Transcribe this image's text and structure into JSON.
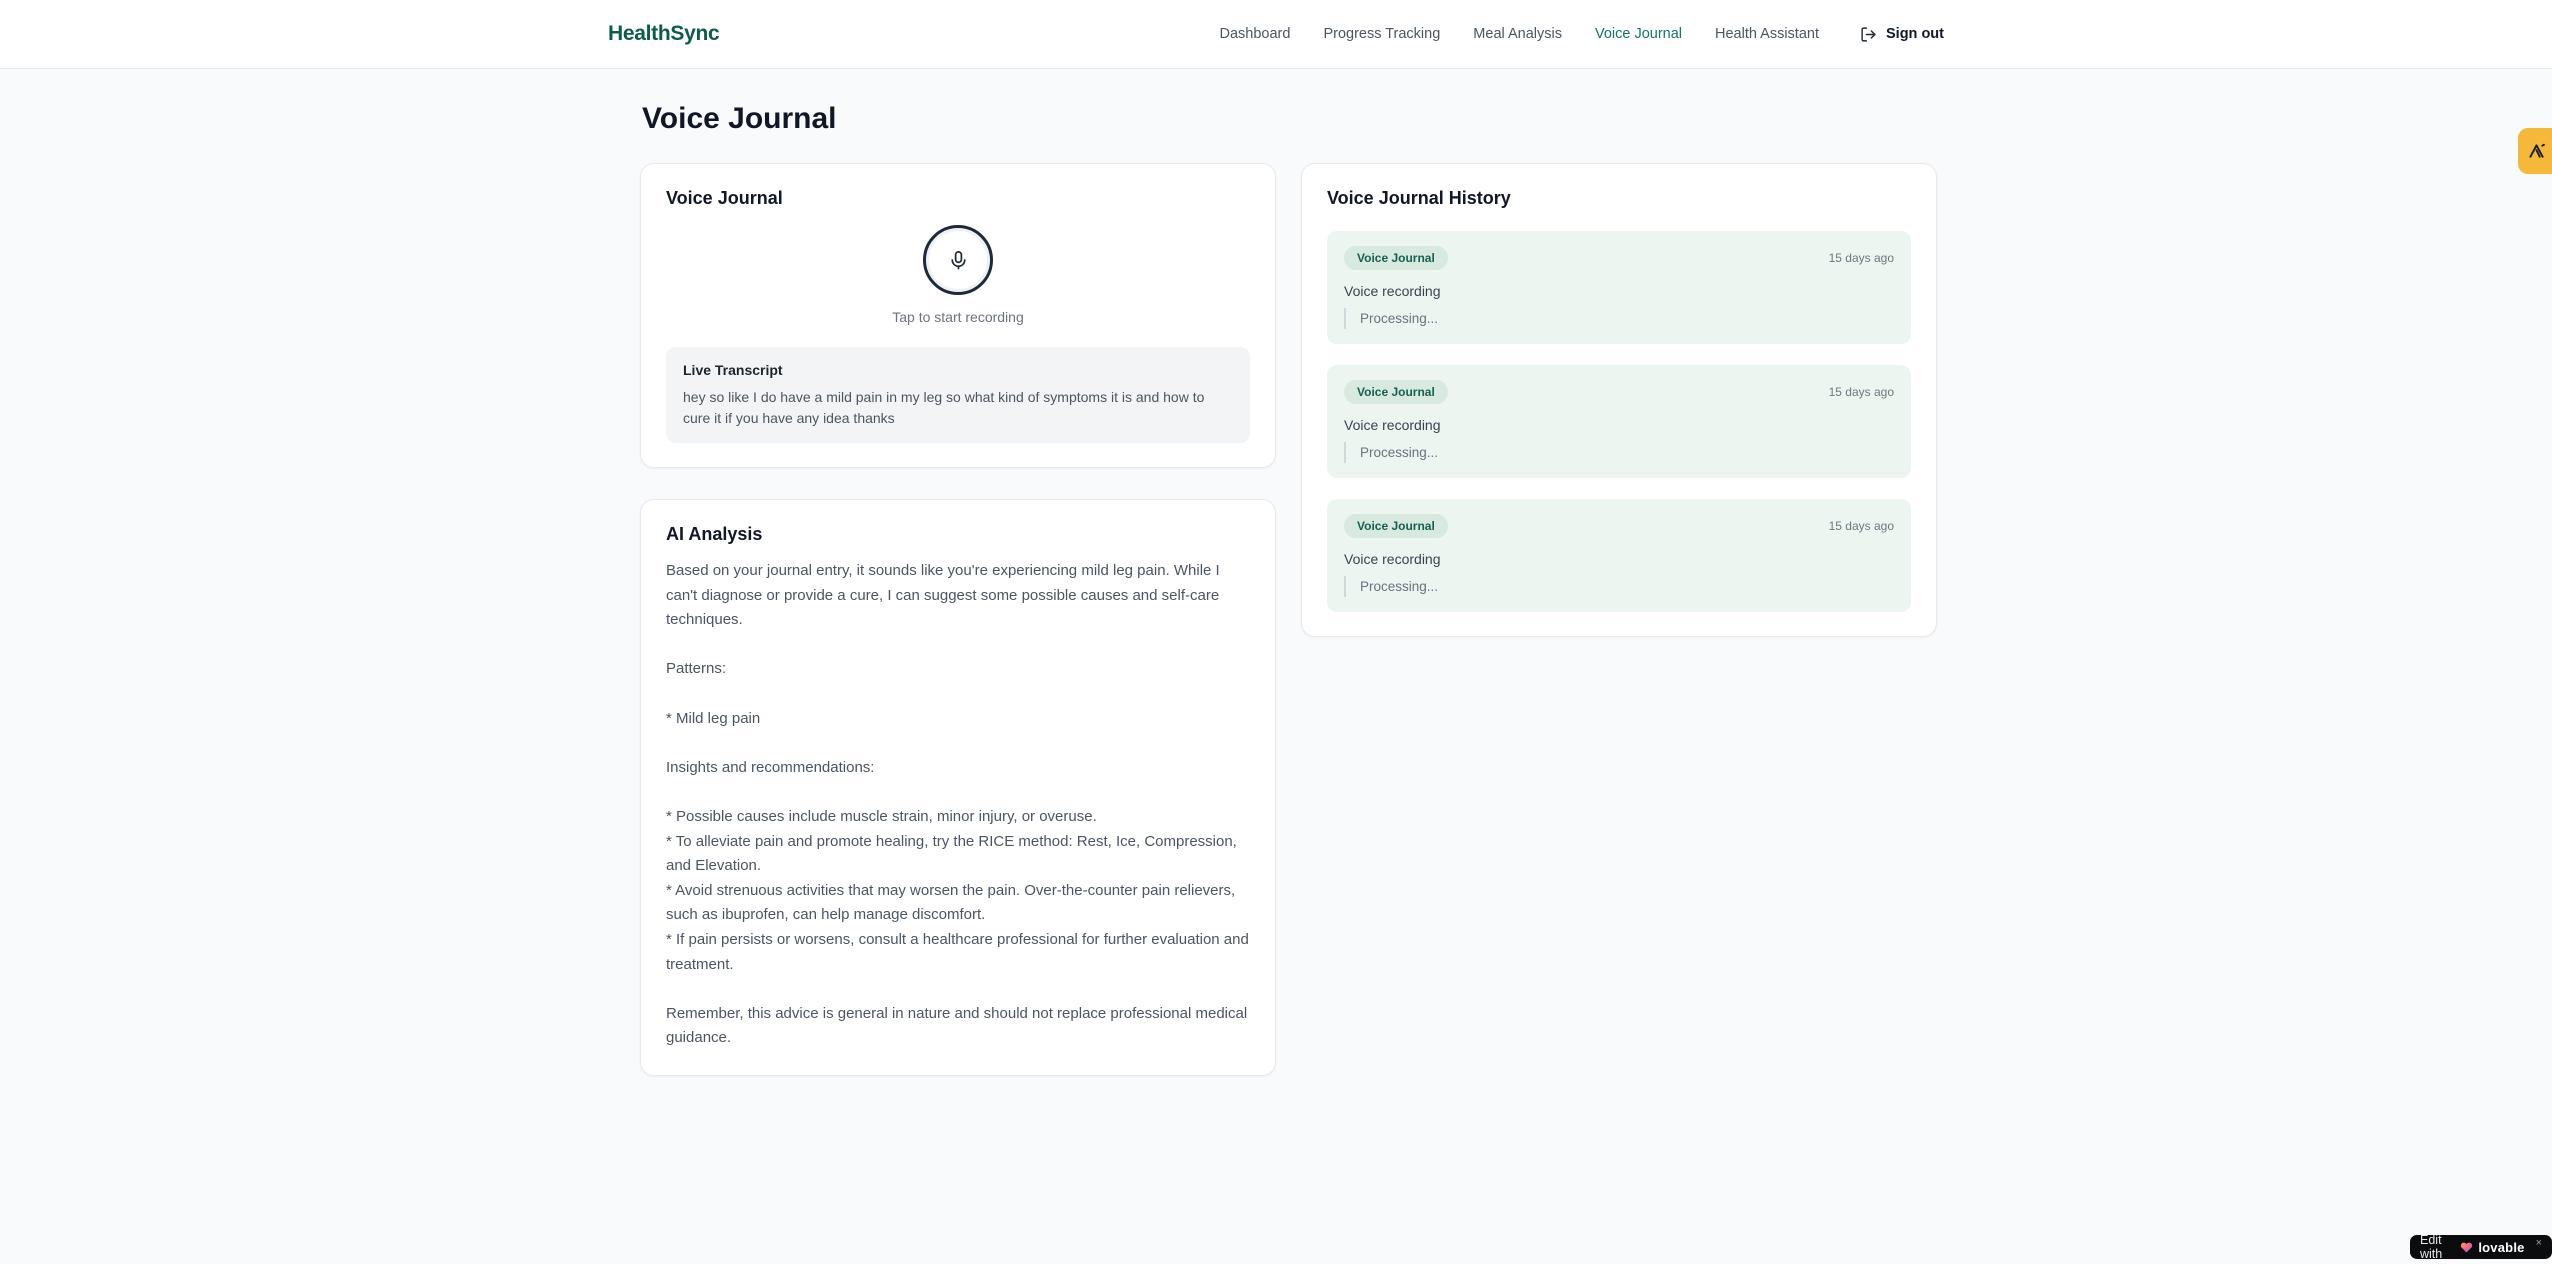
{
  "header": {
    "brand": "HealthSync",
    "nav": [
      {
        "label": "Dashboard",
        "active": false
      },
      {
        "label": "Progress Tracking",
        "active": false
      },
      {
        "label": "Meal Analysis",
        "active": false
      },
      {
        "label": "Voice Journal",
        "active": true
      },
      {
        "label": "Health Assistant",
        "active": false
      }
    ],
    "sign_out_label": "Sign out"
  },
  "page": {
    "title": "Voice Journal"
  },
  "recorder_card": {
    "title": "Voice Journal",
    "tap_hint": "Tap to start recording",
    "transcript_title": "Live Transcript",
    "transcript_text": "hey so like I do have a mild pain in my leg so what kind of symptoms it is and how to cure it if you have any idea thanks"
  },
  "analysis_card": {
    "title": "AI Analysis",
    "body": "Based on your journal entry, it sounds like you're experiencing mild leg pain. While I can't diagnose or provide a cure, I can suggest some possible causes and self-care techniques.\n\nPatterns:\n\n* Mild leg pain\n\nInsights and recommendations:\n\n* Possible causes include muscle strain, minor injury, or overuse.\n* To alleviate pain and promote healing, try the RICE method: Rest, Ice, Compression, and Elevation.\n* Avoid strenuous activities that may worsen the pain. Over-the-counter pain relievers, such as ibuprofen, can help manage discomfort.\n* If pain persists or worsens, consult a healthcare professional for further evaluation and treatment.\n\nRemember, this advice is general in nature and should not replace professional medical guidance."
  },
  "history_card": {
    "title": "Voice Journal History",
    "entries": [
      {
        "badge": "Voice Journal",
        "time": "15 days ago",
        "title": "Voice recording",
        "status": "Processing..."
      },
      {
        "badge": "Voice Journal",
        "time": "15 days ago",
        "title": "Voice recording",
        "status": "Processing..."
      },
      {
        "badge": "Voice Journal",
        "time": "15 days ago",
        "title": "Voice recording",
        "status": "Processing..."
      }
    ]
  },
  "floating": {
    "lovable_badge": {
      "prefix": "Edit with",
      "brand": "lovable",
      "close": "×"
    }
  },
  "colors": {
    "brand_green": "#0c5c4b",
    "nav_active_teal": "#11756b",
    "entry_bg_mint": "#edf5f0",
    "badge_bg": "#d8e9df",
    "badge_text": "#166052",
    "amber_widget": "#f6b83a",
    "page_bg": "#f9fafb"
  }
}
